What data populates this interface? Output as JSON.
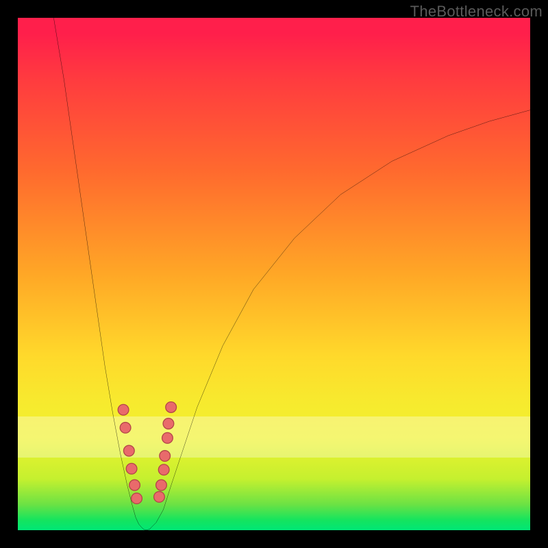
{
  "watermark": "TheBottleneck.com",
  "colors": {
    "frame": "#000000",
    "gradient_top": "#ff1f4b",
    "gradient_mid": "#ffd92b",
    "gradient_bottom": "#00e676",
    "curve": "#000000",
    "dot_fill": "#e96a6b",
    "dot_stroke": "#b34748"
  },
  "chart_data": {
    "type": "line",
    "title": "",
    "xlabel": "",
    "ylabel": "",
    "xlim": [
      0,
      100
    ],
    "ylim": [
      0,
      100
    ],
    "grid": false,
    "legend": false,
    "left_branch": {
      "notes": "steep descending left arm of V-curve",
      "x": [
        7,
        9,
        11,
        13,
        15,
        17,
        18.5,
        20,
        21.3,
        22.3,
        23,
        23.6,
        24.2
      ],
      "y": [
        100,
        88,
        74,
        60,
        46,
        32,
        23,
        15,
        9,
        5,
        2.5,
        1.2,
        0.5
      ]
    },
    "right_branch": {
      "notes": "ascending right arm, concave, asymptoting high",
      "x": [
        26,
        27,
        28.4,
        30,
        32,
        35,
        40,
        46,
        54,
        63,
        73,
        84,
        92,
        100
      ],
      "y": [
        0.5,
        1.5,
        4,
        9,
        15,
        24,
        36,
        47,
        57,
        65.5,
        72,
        77,
        79.8,
        82
      ]
    },
    "valley": {
      "notes": "flat bottom of V near y=0",
      "x": [
        24.2,
        24.6,
        25,
        25.4,
        25.8,
        26
      ],
      "y": [
        0.5,
        0.15,
        0.05,
        0.1,
        0.25,
        0.5
      ]
    },
    "markers": {
      "notes": "salmon dots clustered on both arms near the valley, roughly between y=6 and y=25",
      "points": [
        {
          "x": 20.6,
          "y": 23.5
        },
        {
          "x": 21.0,
          "y": 20.0
        },
        {
          "x": 21.7,
          "y": 15.5
        },
        {
          "x": 22.2,
          "y": 12.0
        },
        {
          "x": 22.8,
          "y": 8.8
        },
        {
          "x": 23.2,
          "y": 6.2
        },
        {
          "x": 27.6,
          "y": 6.5
        },
        {
          "x": 28.0,
          "y": 8.8
        },
        {
          "x": 28.5,
          "y": 11.8
        },
        {
          "x": 28.7,
          "y": 14.5
        },
        {
          "x": 29.2,
          "y": 18.0
        },
        {
          "x": 29.4,
          "y": 20.8
        },
        {
          "x": 29.9,
          "y": 24.0
        }
      ]
    }
  }
}
